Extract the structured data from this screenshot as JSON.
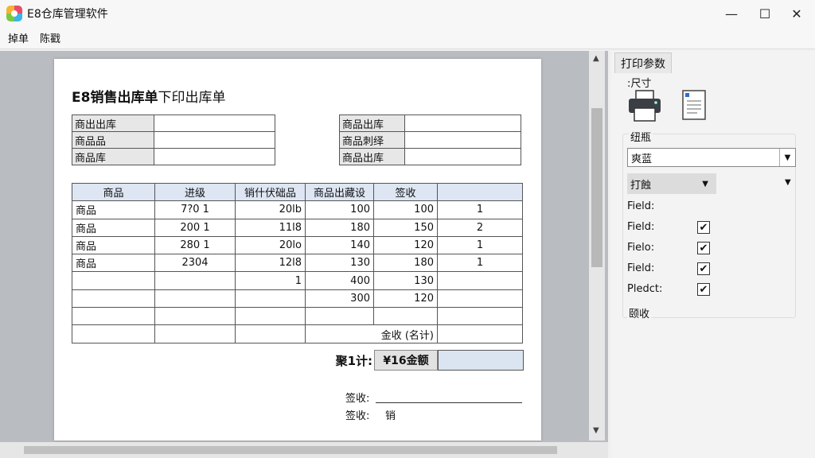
{
  "window": {
    "title": "E8仓库管理软件",
    "minimize": "—",
    "maximize": "☐",
    "close": "✕"
  },
  "menu": [
    "掉单",
    "陈戳"
  ],
  "doc": {
    "title_main": "E8销售出库单",
    "title_sub": "下印出库单",
    "left_fields": [
      "商出出库",
      "商品品",
      "商品库"
    ],
    "right_fields": [
      "商品出库",
      "商品刺绎",
      "商品出库"
    ],
    "columns": [
      "商品",
      "进级",
      "销什伏础品",
      "商品出藏设",
      "签收",
      ""
    ],
    "rows": [
      [
        "商品",
        "7?0 1",
        "20lb",
        "100",
        "100",
        "1"
      ],
      [
        "商品",
        "200 1",
        "11l8",
        "180",
        "150",
        "2"
      ],
      [
        "商品",
        "280 1",
        "20lo",
        "140",
        "120",
        "1"
      ],
      [
        "商品",
        "2304",
        "12l8",
        "130",
        "180",
        "1"
      ],
      [
        "",
        "",
        "1",
        "400",
        "130",
        ""
      ],
      [
        "",
        "",
        "",
        "300",
        "120",
        ""
      ]
    ],
    "summary_label": "金收 (名计)",
    "total_label": "聚1计:",
    "total_value": "¥16金额",
    "sign1": "签收:",
    "sign2": "签收:",
    "sign2_value": "销"
  },
  "panel": {
    "tab": "打印参数",
    "size_label": ":尺寸",
    "paper_group": "纽瓶",
    "select_value": "爽蓝",
    "button_label": "打蝕",
    "fields": [
      {
        "label": "Field:",
        "checked": false
      },
      {
        "label": "Field:",
        "checked": true
      },
      {
        "label": "Fielo:",
        "checked": true
      },
      {
        "label": "Field:",
        "checked": true
      },
      {
        "label": "Pledct:",
        "checked": true
      }
    ],
    "bottom_label": "颐收"
  }
}
